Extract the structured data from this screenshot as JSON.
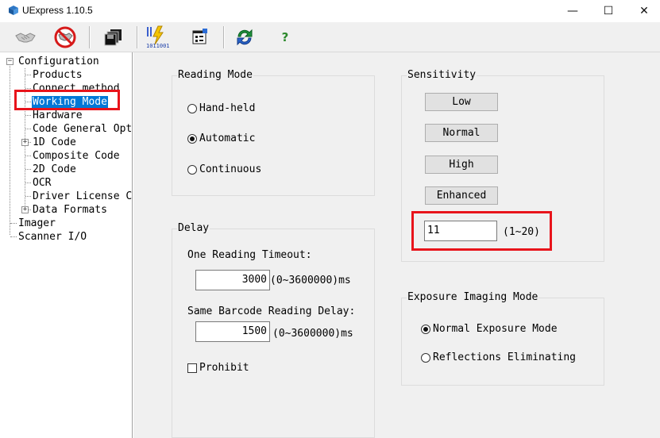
{
  "window": {
    "title": "UExpress 1.10.5",
    "min": "—",
    "max": "☐",
    "close": "✕"
  },
  "toolbar": {
    "buttons": [
      {
        "name": "connect"
      },
      {
        "name": "disconnect"
      },
      {
        "name": "save-settings"
      },
      {
        "name": "firmware-update"
      },
      {
        "name": "properties"
      },
      {
        "name": "refresh"
      },
      {
        "name": "help",
        "glyph": "?"
      }
    ]
  },
  "tree": {
    "root": "Configuration",
    "items": [
      "Products",
      "Connect method",
      "Working Mode",
      "Hardware",
      "Code General Opti",
      "1D Code",
      "Composite Code",
      "2D Code",
      "OCR",
      "Driver License Co",
      "Data Formats"
    ],
    "imager": "Imager",
    "scanner_io": "Scanner I/O",
    "selected": "Working Mode"
  },
  "reading_mode": {
    "title": "Reading Mode",
    "options": [
      "Hand-held",
      "Automatic",
      "Continuous"
    ],
    "selected": "Automatic"
  },
  "delay": {
    "title": "Delay",
    "timeout_label": "One Reading Timeout:",
    "timeout_value": "3000",
    "timeout_range": "(0~3600000)ms",
    "same_label": "Same Barcode Reading Delay:",
    "same_value": "1500",
    "same_range": "(0~3600000)ms",
    "prohibit": "Prohibit"
  },
  "sensitivity": {
    "title": "Sensitivity",
    "buttons": [
      "Low",
      "Normal",
      "High",
      "Enhanced"
    ],
    "value": "11",
    "range": "(1~20)"
  },
  "exposure": {
    "title": "Exposure Imaging Mode",
    "options": [
      "Normal Exposure Mode",
      "Reflections Eliminating"
    ],
    "selected": "Normal Exposure Mode"
  },
  "colors": {
    "highlight": "#e8141b",
    "selection": "#0078d7",
    "panel": "#f0f0f0"
  }
}
